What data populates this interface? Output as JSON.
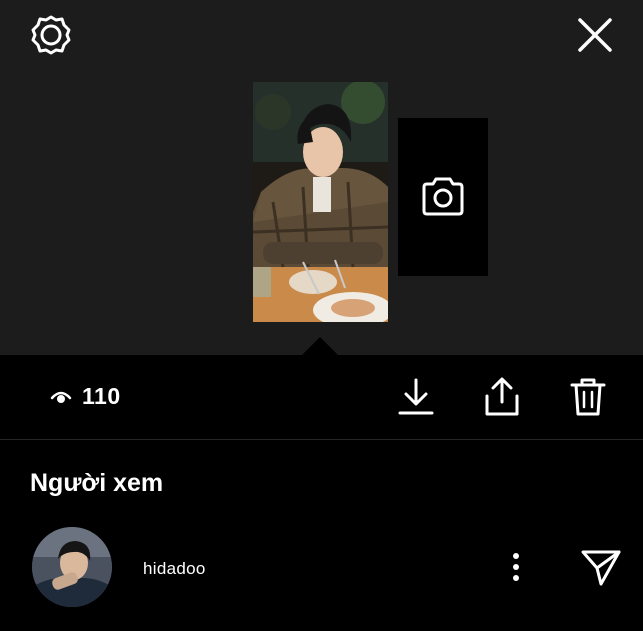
{
  "header": {
    "settings_icon": "gear-icon",
    "close_icon": "close-icon"
  },
  "story": {
    "thumbnail": "story-photo",
    "camera_icon": "camera-icon"
  },
  "actions": {
    "views_icon": "eye-icon",
    "views_count": "110",
    "download_icon": "download-icon",
    "share_icon": "share-icon",
    "delete_icon": "trash-icon"
  },
  "viewers": {
    "title": "Người xem",
    "items": [
      {
        "username": "hidadoo",
        "more_icon": "more-vertical-icon",
        "send_icon": "send-icon"
      }
    ]
  }
}
